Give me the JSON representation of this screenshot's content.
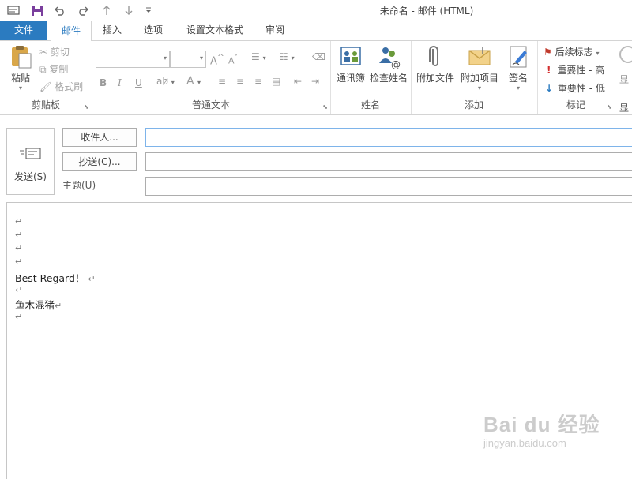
{
  "window": {
    "title": "未命名 - 邮件 (HTML)"
  },
  "tabs": [
    {
      "label": "文件"
    },
    {
      "label": "邮件"
    },
    {
      "label": "插入"
    },
    {
      "label": "选项"
    },
    {
      "label": "设置文本格式"
    },
    {
      "label": "审阅"
    }
  ],
  "ribbon": {
    "clipboard": {
      "paste": "粘贴",
      "cut": "剪切",
      "copy": "复制",
      "format_painter": "格式刷",
      "label": "剪贴板"
    },
    "basic_text": {
      "label": "普通文本"
    },
    "names": {
      "address_book": "通讯簿",
      "check_names": "检查姓名",
      "label": "姓名"
    },
    "include": {
      "attach_file": "附加文件",
      "attach_item": "附加项目",
      "signature": "签名",
      "label": "添加"
    },
    "tags": {
      "follow_up": "后续标志",
      "high_importance": "重要性 - 高",
      "low_importance": "重要性 - 低",
      "label": "标记"
    },
    "cut_off_label_top": "显",
    "cut_off_label_bottom": "显"
  },
  "compose": {
    "send": "发送(S)",
    "to": "收件人...",
    "cc": "抄送(C)...",
    "subject": "主题(U)",
    "to_value": "",
    "cc_value": "",
    "subject_value": ""
  },
  "body": {
    "paragraph_mark": "↵",
    "line1": "Best Regard！",
    "line2": "鱼木混猪"
  },
  "watermark": {
    "brand": "Bai du 经验",
    "url": "jingyan.baidu.com"
  }
}
